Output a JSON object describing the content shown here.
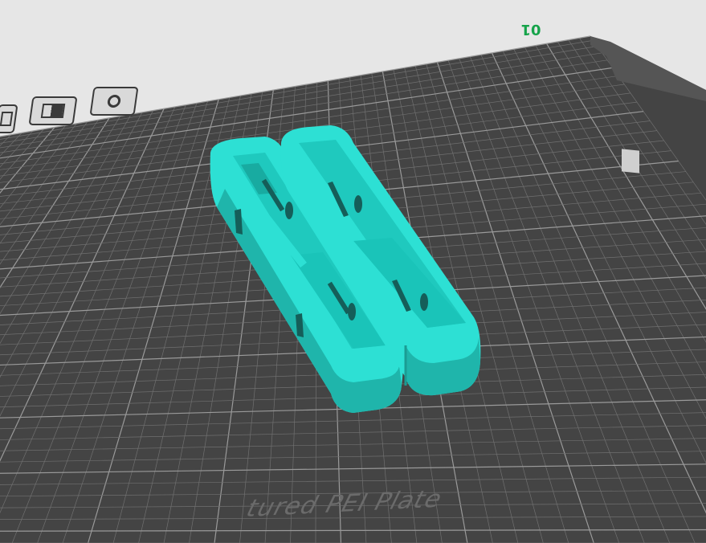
{
  "plate": {
    "number": "01",
    "label": "tured PEI Plate"
  },
  "plate_toolbar": {
    "icons": [
      "plate-list-icon",
      "arrange-icon",
      "settings-icon"
    ]
  },
  "colors": {
    "background": "#e6e6e6",
    "plate": "#444444",
    "grid_line": "#707070",
    "grid_major": "#9a9a9a",
    "model": "#2de0d4",
    "model_shade": "#1fb5ab",
    "plate_number": "#16a34a"
  }
}
